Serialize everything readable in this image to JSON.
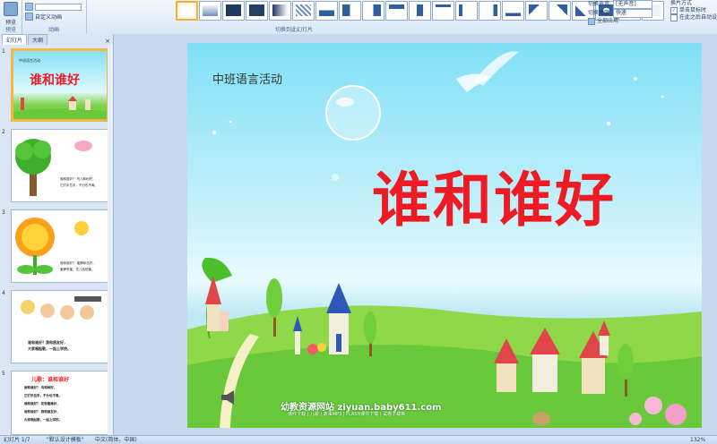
{
  "ribbon": {
    "preview_label": "预览",
    "preview_group_label": "预览",
    "anim_effect_label": "自定义动画",
    "animation_label": "动画",
    "anim_select_value": "",
    "transition_group_label": "切换到此幻灯片",
    "sound_label": "切换声音:",
    "sound_value": "[无声音]",
    "speed_label": "切换速度:",
    "speed_value": "快速",
    "apply_all_label": "全部应用",
    "advance_label": "换片方式",
    "on_click_label": "单击鼠标时",
    "auto_label": "在此之后自动设置"
  },
  "left_panel": {
    "tabs": [
      "幻灯片",
      "大纲"
    ],
    "close_glyph": "×",
    "slides": [
      {
        "num": "1",
        "title": "谁和谁好",
        "tag": "中班语言活动"
      },
      {
        "num": "2",
        "lines": [
          "谁和谁好？ 鸟儿和树好，",
          "它们手拉手，不分也不离。"
        ]
      },
      {
        "num": "3",
        "lines": [
          "谁和谁好？ 蜜蜂和花好，",
          "蜜蜂采蜜，花儿给他蜜。"
        ]
      },
      {
        "num": "4",
        "lines": [
          "谁和谁好？我和朋友好，",
          "大家唱起歌，一起上学校。"
        ]
      },
      {
        "num": "5",
        "title": "儿歌：谁和谁好",
        "lines": [
          "谁和谁好？ 鸟和树好，",
          "它们手拉手，不分也不离。",
          "谁和谁好？ 花和蜜蜂好，",
          "谁和谁好？ 我和朋友好，",
          "大家唱起歌，一起上学校。"
        ]
      }
    ]
  },
  "slide": {
    "subtitle": "中班语言活动",
    "title": "谁和谁好",
    "site": "幼教资源网站 ziyuan.baby611.com",
    "site_sub": "课件下载 | 儿歌 | 故事MP3 | FLASH课件下载 | 试卷下载等"
  },
  "status": {
    "slide_pos": "幻灯片 1/7",
    "theme": "\"默认设计模板\"",
    "lang": "中文(简体，中国)",
    "zoom": "132%"
  },
  "colors": {
    "title_red": "#ee1b24",
    "sky_top": "#7fe0f6",
    "grass": "#6ac83b",
    "selection_orange": "#f7b640"
  }
}
